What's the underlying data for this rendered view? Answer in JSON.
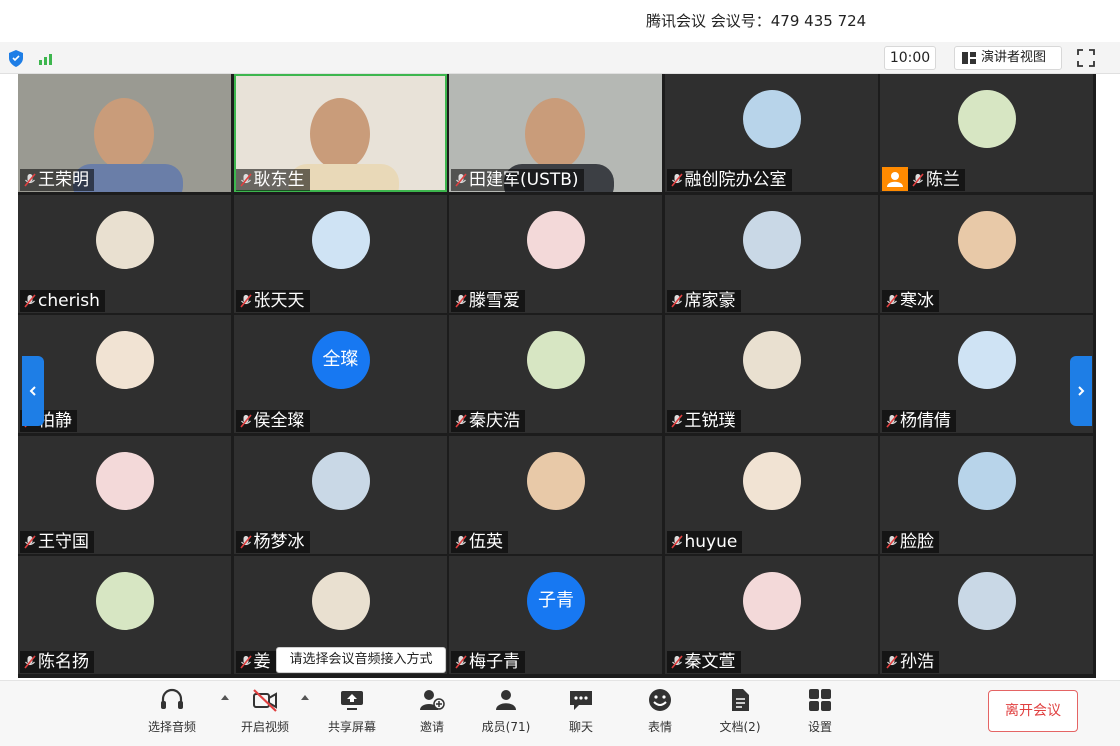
{
  "window": {
    "title": "腾讯会议 会议号：479 435 724"
  },
  "top_bar": {
    "timer": "10:00",
    "speaker_view_label": "演讲者视图"
  },
  "participants": [
    {
      "name": "王荣明",
      "video": true,
      "active": false
    },
    {
      "name": "耿东生",
      "video": true,
      "active": true
    },
    {
      "name": "田建军(USTB)",
      "video": true,
      "active": false
    },
    {
      "name": "融创院办公室",
      "video": false,
      "active": false
    },
    {
      "name": "陈兰",
      "video": false,
      "active": false,
      "host": true
    },
    {
      "name": "cherish",
      "video": false
    },
    {
      "name": "张天天",
      "video": false
    },
    {
      "name": "滕雪爱",
      "video": false
    },
    {
      "name": "席家豪",
      "video": false
    },
    {
      "name": "寒冰",
      "video": false
    },
    {
      "name": "柏静",
      "video": false
    },
    {
      "name": "侯全璨",
      "video": false,
      "avatar_text": "全璨"
    },
    {
      "name": "秦庆浩",
      "video": false
    },
    {
      "name": "王锐璞",
      "video": false
    },
    {
      "name": "杨倩倩",
      "video": false
    },
    {
      "name": "王守国",
      "video": false
    },
    {
      "name": "杨梦冰",
      "video": false
    },
    {
      "name": "伍英",
      "video": false
    },
    {
      "name": "huyue",
      "video": false
    },
    {
      "name": "脸脸",
      "video": false
    },
    {
      "name": "陈名扬",
      "video": false
    },
    {
      "name": "姜",
      "video": false
    },
    {
      "name": "梅子青",
      "video": false,
      "avatar_text": "子青"
    },
    {
      "name": "秦文萱",
      "video": false
    },
    {
      "name": "孙浩",
      "video": false
    }
  ],
  "tooltip": "请选择会议音频接入方式",
  "bottom_bar": {
    "audio": "选择音频",
    "video": "开启视频",
    "share": "共享屏幕",
    "invite": "邀请",
    "members": "成员(71)",
    "chat": "聊天",
    "emoji": "表情",
    "docs": "文档(2)",
    "settings": "设置",
    "leave": "离开会议"
  },
  "colors": {
    "accent": "#1e7ee6",
    "leave": "#e04040",
    "active_border": "#3db64e",
    "host_badge": "#ff8a00"
  }
}
